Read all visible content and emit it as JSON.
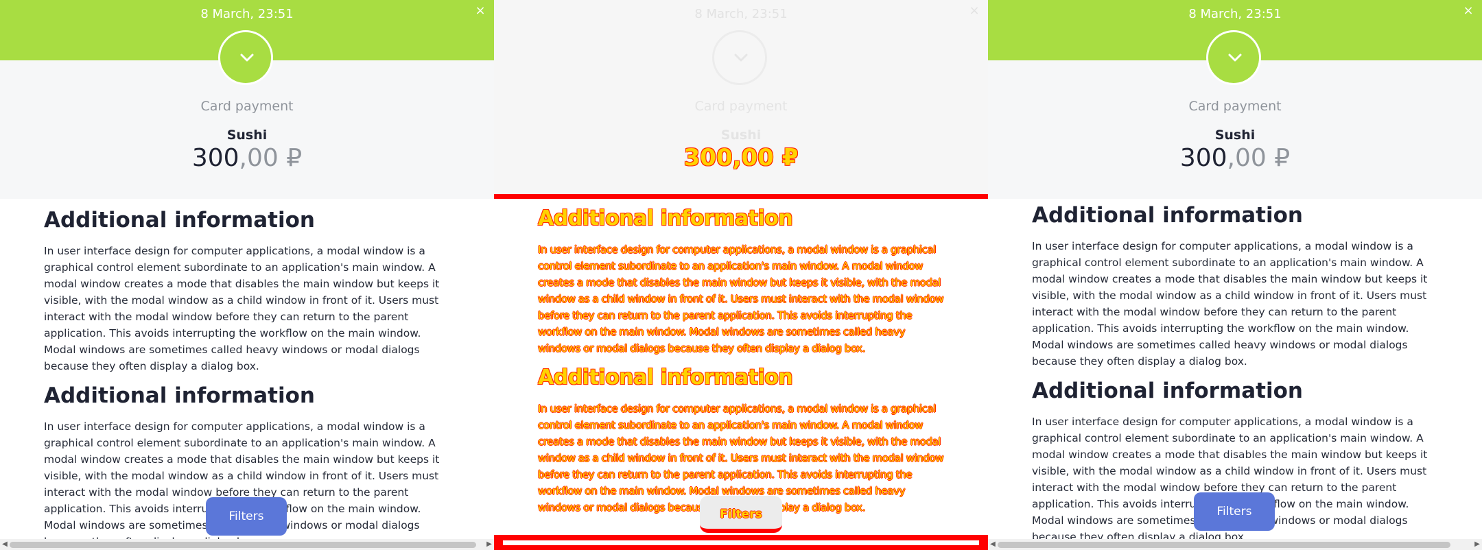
{
  "receipt": {
    "datetime": "8 March, 23:51",
    "close_glyph": "×",
    "status_icon": "chevron-down-icon",
    "method": "Card payment",
    "merchant": "Sushi",
    "amount_int": "300",
    "amount_frac": ",00",
    "currency": "₽"
  },
  "sections": [
    {
      "heading": "Additional information",
      "body": "In user interface design for computer applications, a modal window is a graphical control element subordinate to an application's main window. A modal window creates a mode that disables the main window but keeps it visible, with the modal window as a child window in front of it. Users must interact with the modal window before they can return to the parent application. This avoids interrupting the workflow on the main window. Modal windows are sometimes called heavy windows or modal dialogs because they often display a dialog box."
    },
    {
      "heading": "Additional information",
      "body": "In user interface design for computer applications, a modal window is a graphical control element subordinate to an application's main window. A modal window creates a mode that disables the main window but keeps it visible, with the modal window as a child window in front of it. Users must interact with the modal window before they can return to the parent application. This avoids interrupting the workflow on the main window. Modal windows are sometimes called heavy windows or modal dialogs because they often display a dialog box."
    }
  ],
  "filters_label": "Filters",
  "scroll": {
    "left_arrow": "◀",
    "right_arrow": "▶"
  },
  "colors": {
    "accent_green": "#a8dd42",
    "button_blue": "#5b77d9",
    "debug_red": "#ff0000",
    "debug_yellow": "#ffd200"
  }
}
